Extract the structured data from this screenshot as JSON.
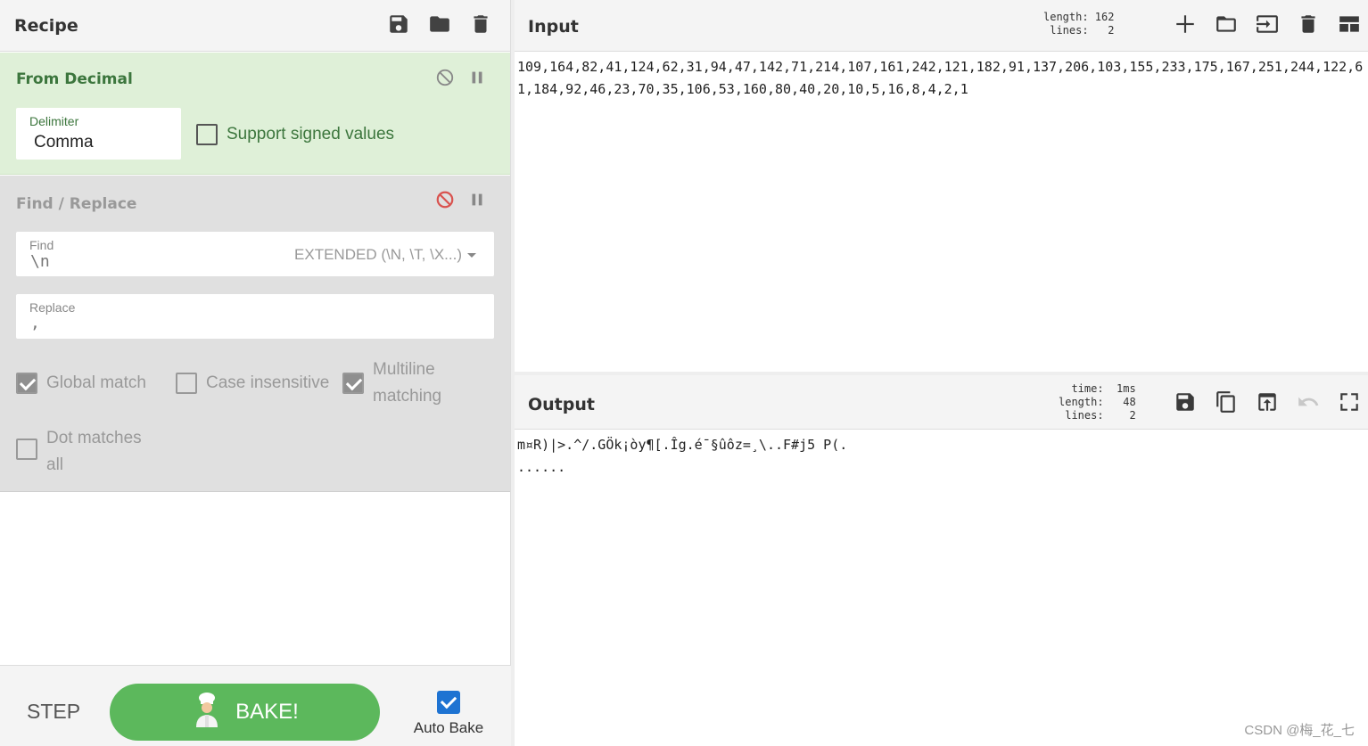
{
  "recipe": {
    "title": "Recipe",
    "icons": [
      "save-icon",
      "folder-icon",
      "trash-icon"
    ],
    "operations": [
      {
        "name": "From Decimal",
        "delimiter_label": "Delimiter",
        "delimiter_value": "Comma",
        "signed_label": "Support signed values",
        "signed_checked": false
      },
      {
        "name": "Find / Replace",
        "find_label": "Find",
        "find_value": "\\n",
        "find_mode": "EXTENDED (\\N, \\T, \\X...)",
        "replace_label": "Replace",
        "replace_value": ",",
        "global_label": "Global match",
        "global_checked": true,
        "case_label": "Case insensitive",
        "case_checked": false,
        "multiline_label": "Multiline matching",
        "multiline_checked": true,
        "dotall_label": "Dot matches all",
        "dotall_checked": false
      }
    ],
    "step_label": "STEP",
    "bake_label": "BAKE!",
    "autobake_label": "Auto Bake",
    "autobake_checked": true
  },
  "input": {
    "title": "Input",
    "stats": "length: 162\n lines:   2",
    "text": "109,164,82,41,124,62,31,94,47,142,71,214,107,161,242,121,182,91,137,206,103,155,233,175,167,251,244,122,61,184,92,46,23,70,35,106,53,160,80,40,20,10,5,16,8,4,2,1",
    "icons": [
      "plus-icon",
      "folder-icon",
      "import-icon",
      "trash-icon",
      "layout-icon"
    ]
  },
  "output": {
    "title": "Output",
    "stats": "  time:  1ms\nlength:   48\n lines:    2",
    "text": "m¤R)|>.^/.GÖk¡òy¶[.Îg.é¯§ûôz=¸\\..F#j5 P(.\n......",
    "icons": [
      "save-icon",
      "copy-icon",
      "replace-input-icon",
      "undo-icon",
      "maximize-icon"
    ]
  },
  "watermark": "CSDN @梅_花_七",
  "colors": {
    "active_op_bg": "#dff0d8",
    "disabled_op_bg": "#e0e0e0",
    "bake_green": "#5cb85c",
    "autobake_blue": "#1e73d2",
    "disabled_red": "#d9534f"
  }
}
